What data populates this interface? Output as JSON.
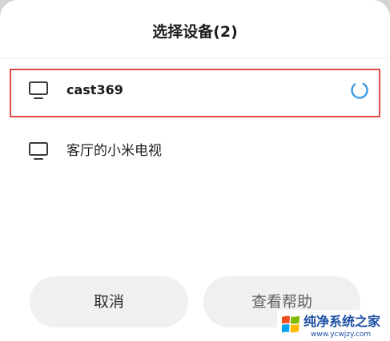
{
  "dialog": {
    "title": "选择设备(2)"
  },
  "devices": [
    {
      "name": "cast369",
      "icon": "monitor-icon",
      "trailing_icon": "loading-spinner-icon"
    },
    {
      "name": "客厅的小米电视",
      "icon": "monitor-icon"
    }
  ],
  "buttons": {
    "cancel_label": "取消",
    "help_label": "查看帮助"
  },
  "watermark": {
    "brand": "纯净系统之家",
    "url": "www.ycwjzy.com",
    "logo_icon": "windows-logo-icon"
  },
  "colors": {
    "text_primary": "#1c1c1c",
    "accent": "#3a9bea",
    "highlight_border": "#df4a4a",
    "button_bg": "#f0f0f0",
    "divider": "#ededed",
    "watermark_blue": "#1d4fa3"
  }
}
